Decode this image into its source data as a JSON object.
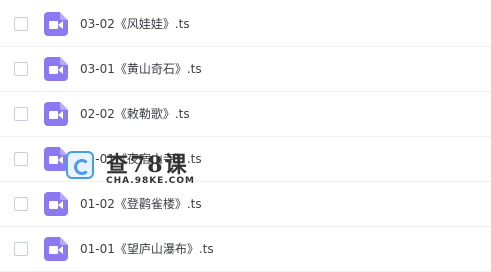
{
  "files": [
    {
      "name": "03-02《风娃娃》.ts",
      "icon": "video-file-icon"
    },
    {
      "name": "03-01《黄山奇石》.ts",
      "icon": "video-file-icon"
    },
    {
      "name": "02-02《敕勒歌》.ts",
      "icon": "video-file-icon"
    },
    {
      "name": "02-01《夜宿山寺》.ts",
      "icon": "video-file-icon"
    },
    {
      "name": "01-02《登鹳雀楼》.ts",
      "icon": "video-file-icon"
    },
    {
      "name": "01-01《望庐山瀑布》.ts",
      "icon": "video-file-icon"
    }
  ],
  "watermark": {
    "title": "查78课",
    "subtitle": "CHA.98KE.COM"
  },
  "colors": {
    "icon_accent": "#8b79f2",
    "watermark_blue": "#4a9ce6"
  }
}
